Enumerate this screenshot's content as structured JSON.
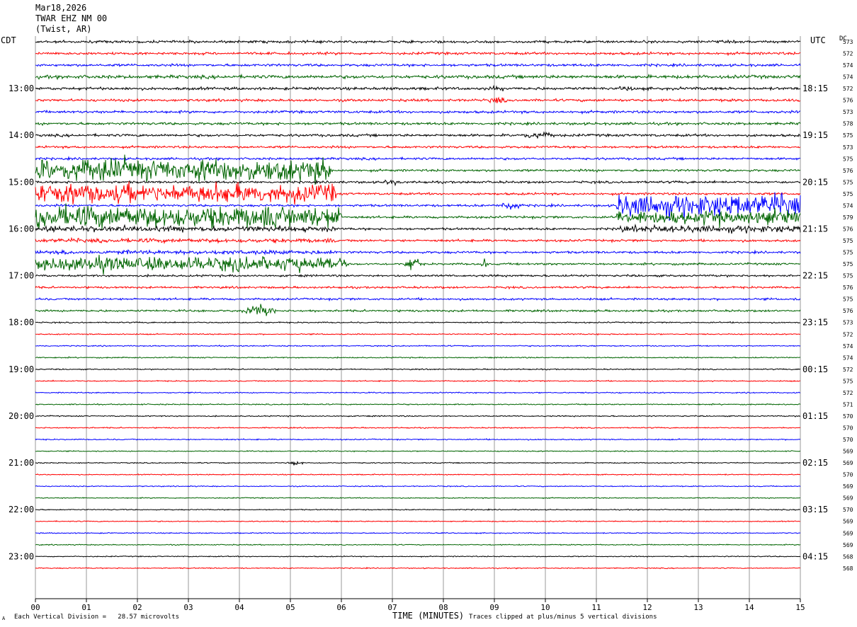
{
  "header": {
    "date": "Mar18,2026",
    "station": "TWAR EHZ NM 00",
    "location": "(Twist, AR)"
  },
  "left_tz": "CDT",
  "right_tz": "UTC",
  "dc_label": "DC",
  "footer": {
    "left_mark": "A",
    "scale_note": "Each Vertical Division =   28.57 microvolts",
    "xlabel": "TIME (MINUTES)",
    "clip_note": "Traces clipped at plus/minus 5 vertical divisions"
  },
  "chart_data": {
    "type": "line",
    "title": "TWAR EHZ NM 00 (Twist, AR) Mar18,2026",
    "xlabel": "TIME (MINUTES)",
    "xlim": [
      0,
      15
    ],
    "x_ticks": [
      "00",
      "01",
      "02",
      "03",
      "04",
      "05",
      "06",
      "07",
      "08",
      "09",
      "10",
      "11",
      "12",
      "13",
      "14",
      "15"
    ],
    "trace_colors": [
      "#000000",
      "#ff0000",
      "#0000ff",
      "#006400"
    ],
    "left_hour_labels": [
      "13:00",
      "14:00",
      "15:00",
      "16:00",
      "17:00",
      "18:00",
      "19:00",
      "20:00",
      "21:00",
      "22:00",
      "23:00"
    ],
    "right_hour_labels": [
      "18:15",
      "19:15",
      "20:15",
      "21:15",
      "22:15",
      "23:15",
      "00:15",
      "01:15",
      "02:15",
      "03:15",
      "04:15"
    ],
    "dc_offsets": [
      573,
      572,
      574,
      574,
      572,
      576,
      573,
      578,
      575,
      573,
      575,
      576,
      575,
      575,
      574,
      579,
      576,
      575,
      575,
      575,
      575,
      576,
      575,
      576,
      573,
      572,
      574,
      574,
      572,
      575,
      572,
      571,
      570,
      570,
      570,
      569,
      569,
      570,
      569,
      569,
      570,
      569,
      569,
      569,
      568,
      568
    ],
    "trace_amplitude": [
      1.0,
      1.0,
      1.0,
      1.3,
      1.1,
      1.0,
      1.0,
      1.0,
      1.0,
      0.9,
      0.9,
      0.9,
      0.9,
      0.9,
      0.9,
      0.9,
      0.9,
      0.9,
      0.9,
      0.8,
      0.8,
      0.8,
      0.8,
      0.8,
      0.5,
      0.45,
      0.45,
      0.45,
      0.45,
      0.45,
      0.45,
      0.45,
      0.45,
      0.45,
      0.45,
      0.4,
      0.4,
      0.4,
      0.4,
      0.4,
      0.4,
      0.4,
      0.4,
      0.4,
      0.4,
      0.4
    ],
    "events": [
      {
        "trace": 4,
        "start_min": 8.6,
        "end_min": 9.4,
        "amp": 4
      },
      {
        "trace": 5,
        "start_min": 8.8,
        "end_min": 9.3,
        "amp": 6
      },
      {
        "trace": 4,
        "start_min": 11.3,
        "end_min": 11.9,
        "amp": 4
      },
      {
        "trace": 8,
        "start_min": 9.2,
        "end_min": 10.4,
        "amp": 5
      },
      {
        "trace": 11,
        "start_min": 0.0,
        "end_min": 5.8,
        "amp": 16
      },
      {
        "trace": 12,
        "start_min": 6.8,
        "end_min": 7.2,
        "amp": 6
      },
      {
        "trace": 13,
        "start_min": 0.0,
        "end_min": 5.9,
        "amp": 14
      },
      {
        "trace": 14,
        "start_min": 9.1,
        "end_min": 9.6,
        "amp": 9
      },
      {
        "trace": 14,
        "start_min": 11.4,
        "end_min": 15.0,
        "amp": 16
      },
      {
        "trace": 15,
        "start_min": 0.0,
        "end_min": 6.0,
        "amp": 16
      },
      {
        "trace": 15,
        "start_min": 11.4,
        "end_min": 15.0,
        "amp": 10
      },
      {
        "trace": 16,
        "start_min": 0.0,
        "end_min": 5.9,
        "amp": 4
      },
      {
        "trace": 16,
        "start_min": 11.4,
        "end_min": 15.0,
        "amp": 5
      },
      {
        "trace": 17,
        "start_min": 0.0,
        "end_min": 5.9,
        "amp": 3
      },
      {
        "trace": 18,
        "start_min": 0.0,
        "end_min": 5.9,
        "amp": 3
      },
      {
        "trace": 19,
        "start_min": 0.0,
        "end_min": 6.1,
        "amp": 10
      },
      {
        "trace": 19,
        "start_min": 7.2,
        "end_min": 7.6,
        "amp": 12
      },
      {
        "trace": 19,
        "start_min": 8.7,
        "end_min": 8.9,
        "amp": 8
      },
      {
        "trace": 23,
        "start_min": 4.0,
        "end_min": 4.8,
        "amp": 10
      },
      {
        "trace": 36,
        "start_min": 4.9,
        "end_min": 5.3,
        "amp": 4
      }
    ]
  }
}
